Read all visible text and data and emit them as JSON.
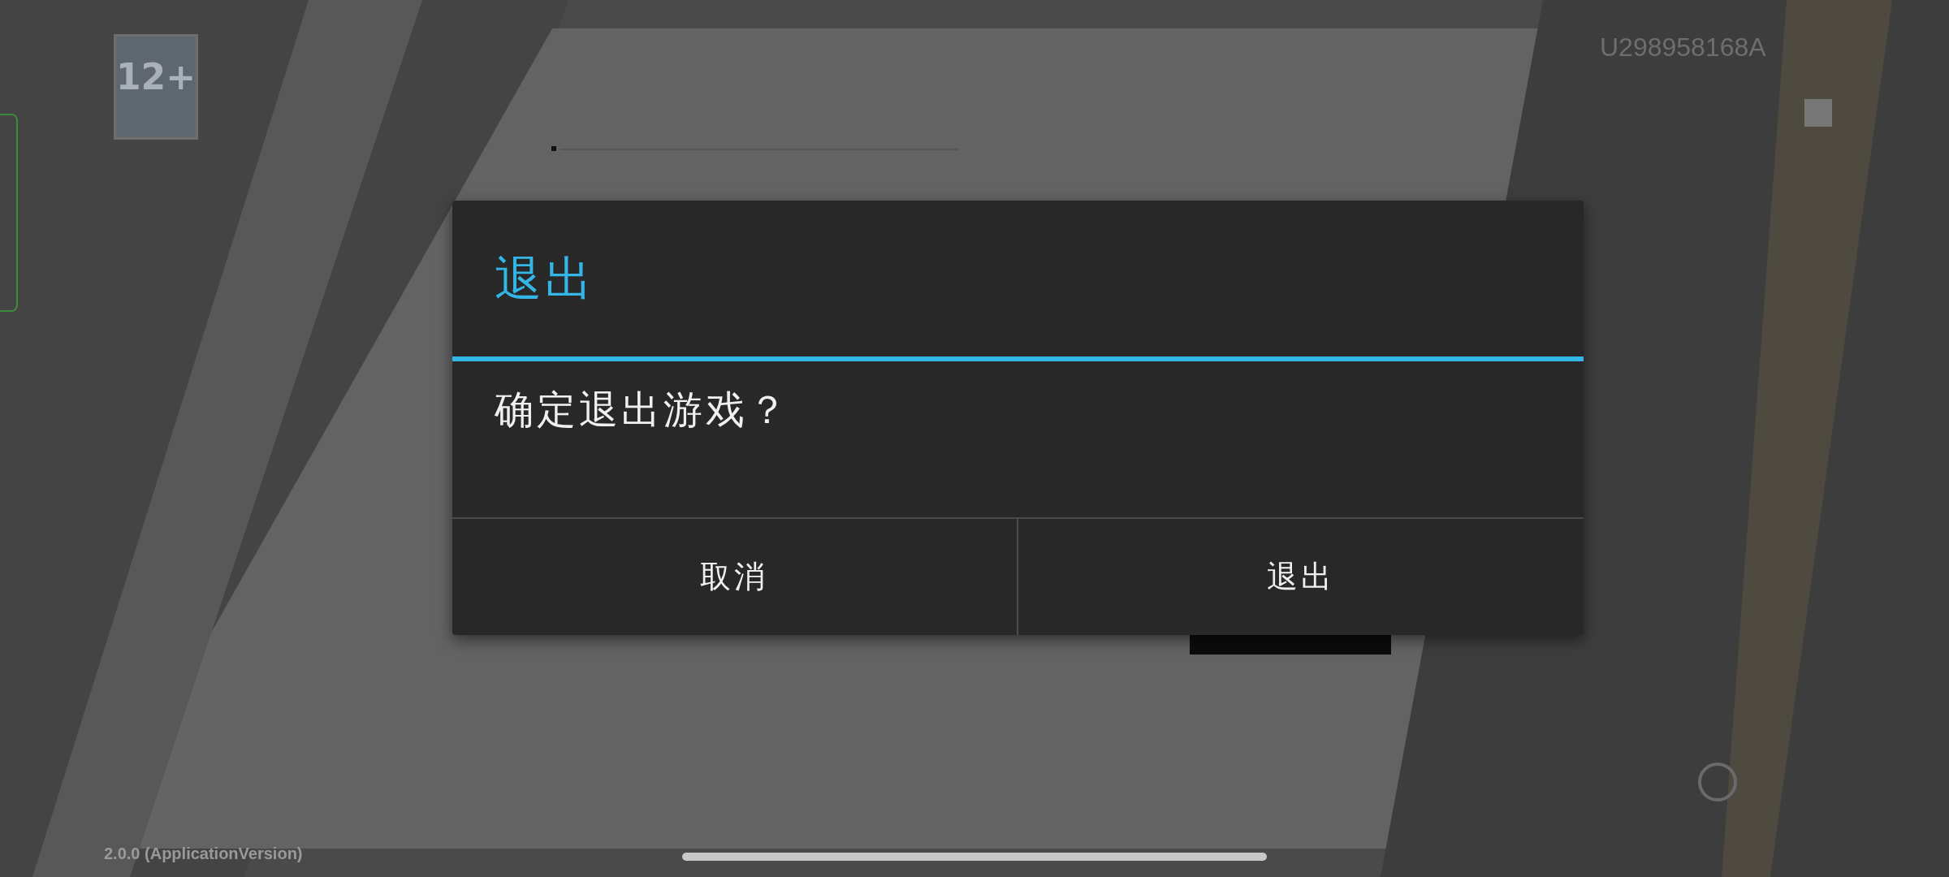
{
  "background": {
    "user_id": "U298958168A",
    "rating": "12+",
    "version": "2.0.0 (ApplicationVersion)"
  },
  "dialog": {
    "title": "退出",
    "message": "确定退出游戏？",
    "buttons": [
      {
        "label": "取消"
      },
      {
        "label": "退出"
      }
    ]
  }
}
